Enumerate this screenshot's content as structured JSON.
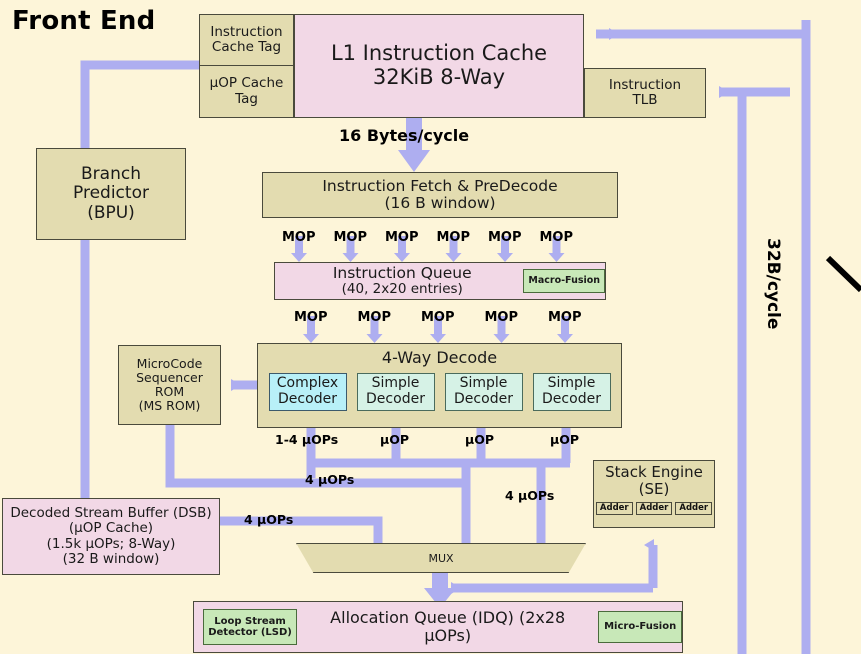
{
  "title": "Front End",
  "colors": {
    "background": "#fdf5d9",
    "tan": "#e3dcb0",
    "pink": "#f2d8e6",
    "green": "#c8e8b8",
    "cyan": "#b8f0f8",
    "mint": "#d6f2e6",
    "arrow": "#aeaef0",
    "border": "#4a4a3c"
  },
  "blocks": {
    "instruction_cache_tag": "Instruction\nCache Tag",
    "uop_cache_tag": "µOP Cache\nTag",
    "l1_icache_line1": "L1 Instruction Cache",
    "l1_icache_line2": "32KiB 8-Way",
    "instruction_tlb": "Instruction\nTLB",
    "branch_predictor_line1": "Branch",
    "branch_predictor_line2": "Predictor",
    "branch_predictor_line3": "(BPU)",
    "fetch_predecode_line1": "Instruction Fetch & PreDecode",
    "fetch_predecode_line2": "(16 B window)",
    "instruction_queue_line1": "Instruction Queue",
    "instruction_queue_line2": "(40, 2x20 entries)",
    "macro_fusion": "Macro-Fusion",
    "decode_title": "4-Way Decode",
    "complex_decoder_line1": "Complex",
    "complex_decoder_line2": "Decoder",
    "simple_decoder_line1": "Simple",
    "simple_decoder_line2": "Decoder",
    "ms_rom_line1": "MicroCode",
    "ms_rom_line2": "Sequencer",
    "ms_rom_line3": "ROM",
    "ms_rom_line4": "(MS ROM)",
    "dsb_line1": "Decoded Stream Buffer (DSB)",
    "dsb_line2": "(µOP Cache)",
    "dsb_line3": "(1.5k µOPs; 8-Way)",
    "dsb_line4": "(32 B window)",
    "stack_engine_line1": "Stack Engine",
    "stack_engine_line2": "(SE)",
    "adder": "Adder",
    "mux": "MUX",
    "lsd_line1": "Loop Stream",
    "lsd_line2": "Detector (LSD)",
    "allocation_queue": "Allocation Queue (IDQ) (2x28 µOPs)",
    "micro_fusion": "Micro-Fusion"
  },
  "labels": {
    "bytes_per_cycle": "16 Bytes/cycle",
    "bandwidth_32b": "32B/cycle",
    "mop": "MOP",
    "uop": "µOP",
    "uops_1_4": "1-4 µOPs",
    "uops_4": "4 µOPs",
    "mop_row_fetch_to_queue": [
      "MOP",
      "MOP",
      "MOP",
      "MOP",
      "MOP",
      "MOP"
    ],
    "mop_row_queue_to_decode": [
      "MOP",
      "MOP",
      "MOP",
      "MOP",
      "MOP"
    ],
    "decoder_outputs": [
      "1-4 µOPs",
      "µOP",
      "µOP",
      "µOP"
    ],
    "uops_4_labels": [
      "4 µOPs",
      "4 µOPs",
      "4 µOPs"
    ]
  },
  "decoders": [
    {
      "type": "complex",
      "line1": "Complex",
      "line2": "Decoder"
    },
    {
      "type": "simple",
      "line1": "Simple",
      "line2": "Decoder"
    },
    {
      "type": "simple",
      "line1": "Simple",
      "line2": "Decoder"
    },
    {
      "type": "simple",
      "line1": "Simple",
      "line2": "Decoder"
    }
  ],
  "adders": [
    "Adder",
    "Adder",
    "Adder"
  ]
}
